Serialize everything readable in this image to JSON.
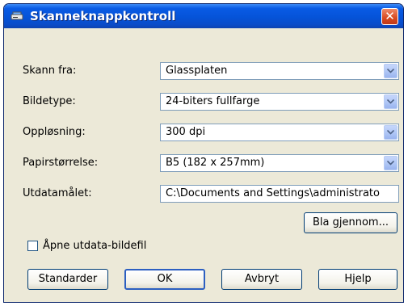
{
  "window": {
    "title": "Skanneknappkontroll",
    "close_label": "✕"
  },
  "form": {
    "rows": [
      {
        "label": "Skann fra:",
        "value": "Glassplaten",
        "type": "dropdown"
      },
      {
        "label": "Bildetype:",
        "value": "24-biters fullfarge",
        "type": "dropdown"
      },
      {
        "label": "Oppløsning:",
        "value": "300 dpi",
        "type": "dropdown"
      },
      {
        "label": "Papirstørrelse:",
        "value": "B5 (182 x 257mm)",
        "type": "dropdown"
      },
      {
        "label": "Utdatamålet:",
        "value": "C:\\Documents and Settings\\administrato",
        "type": "text"
      }
    ],
    "browse_label": "Bla gjennom...",
    "open_checkbox_label": "Åpne utdata-bildefil",
    "open_checkbox_checked": false
  },
  "buttons": {
    "defaults": "Standarder",
    "ok": "OK",
    "cancel": "Avbryt",
    "help": "Hjelp"
  }
}
